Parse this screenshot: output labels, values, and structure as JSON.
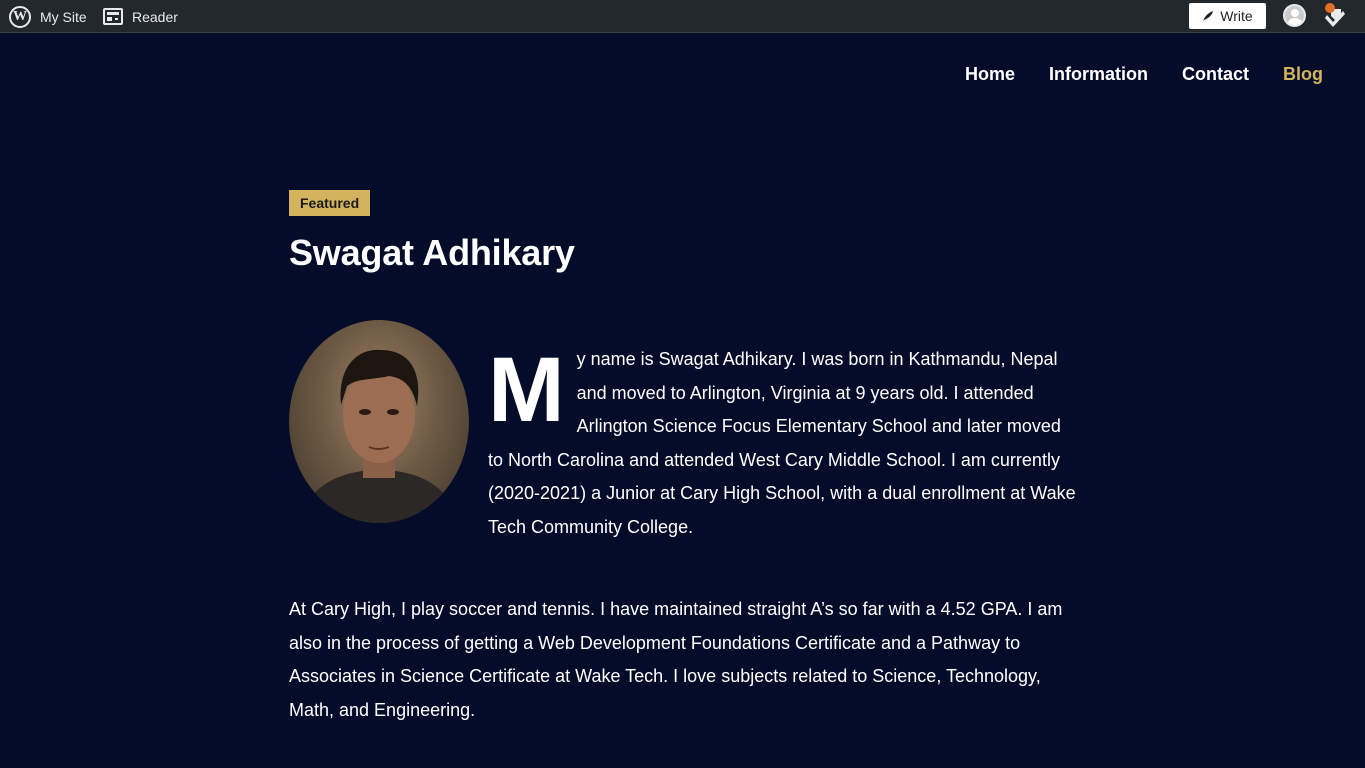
{
  "adminbar": {
    "mysite_label": "My Site",
    "reader_label": "Reader",
    "write_label": "Write"
  },
  "nav": {
    "items": [
      "Home",
      "Information",
      "Contact",
      "Blog"
    ],
    "active": "Blog"
  },
  "post": {
    "badge": "Featured",
    "title": "Swagat Adhikary",
    "dropcap": "M",
    "para1_rest": "y name is Swagat Adhikary. I was born in Kathmandu, Nepal and moved to Arlington, Virginia at 9 years old. I attended Arlington Science Focus Elementary School and later moved to North Carolina and attended West Cary Middle School. I am currently (2020-2021) a Junior at Cary High School, with a dual enrollment at Wake Tech Community College.",
    "para2": "At Cary High, I play soccer and tennis. I have maintained straight A’s so far with a 4.52 GPA. I am also in the process of getting a Web Development Foundations Certificate and a Pathway to Associates in Science Certificate at Wake Tech. I love subjects related to Science, Technology, Math, and Engineering."
  },
  "colors": {
    "background": "#050c2a",
    "accent": "#d3b35e",
    "adminbar": "#23282d",
    "notification": "#e26f27"
  },
  "icons": [
    "wordpress-logo-icon",
    "reader-icon",
    "pen-icon",
    "avatar-icon",
    "notifications-icon"
  ]
}
